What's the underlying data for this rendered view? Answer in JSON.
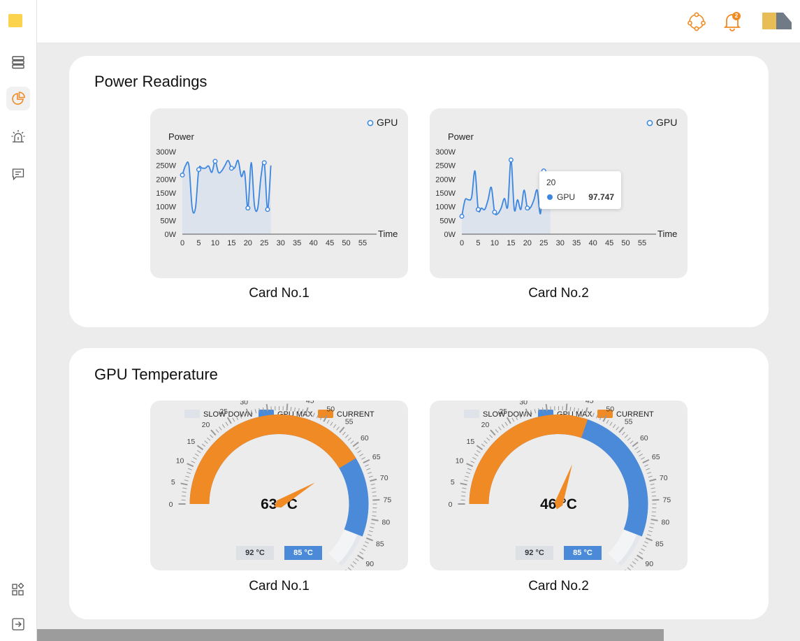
{
  "sidebar": {
    "items": [
      {
        "icon": "server-icon"
      },
      {
        "icon": "pie-chart-icon",
        "active": true
      },
      {
        "icon": "alarm-icon"
      },
      {
        "icon": "message-icon"
      },
      {
        "icon": "apps-icon"
      },
      {
        "icon": "logout-icon"
      }
    ]
  },
  "header": {
    "notifications_count": "2"
  },
  "colors": {
    "accent": "#f08a24",
    "line": "#3b86e0",
    "gpu_max": "#4a8ad8",
    "current": "#f08a24",
    "slow_down": "#dde3e8"
  },
  "power": {
    "title": "Power Readings",
    "cards": [
      {
        "caption": "Card No.1",
        "legend": "GPU",
        "ylabel": "Power",
        "xlabel": "Time"
      },
      {
        "caption": "Card No.2",
        "legend": "GPU",
        "ylabel": "Power",
        "xlabel": "Time",
        "tooltip": {
          "x": "20",
          "series": "GPU",
          "value": "97.747"
        }
      }
    ]
  },
  "temperature": {
    "title": "GPU Temperature",
    "legend": [
      "SLOW DOWN",
      "GPU MAX",
      "CURRENT"
    ],
    "cards": [
      {
        "caption": "Card No.1",
        "value_label": "63 °C",
        "slowdown_label": "92 °C",
        "max_label": "85 °C"
      },
      {
        "caption": "Card No.2",
        "value_label": "46 °C",
        "slowdown_label": "92 °C",
        "max_label": "85 °C"
      }
    ]
  },
  "chart_data": [
    {
      "type": "line",
      "title": "Card No.1",
      "xlabel": "Time",
      "ylabel": "Power",
      "x_ticks": [
        "0",
        "5",
        "10",
        "15",
        "20",
        "25",
        "30",
        "35",
        "40",
        "45",
        "50",
        "55"
      ],
      "y_ticks": [
        "0W",
        "50W",
        "100W",
        "150W",
        "200W",
        "250W",
        "300W"
      ],
      "xlim": [
        0,
        55
      ],
      "ylim": [
        0,
        300
      ],
      "series": [
        {
          "name": "GPU",
          "x": [
            0,
            1,
            2,
            3,
            4,
            5,
            6,
            7,
            8,
            9,
            10,
            11,
            12,
            13,
            14,
            15,
            16,
            17,
            18,
            19,
            20,
            21,
            22,
            23,
            24,
            25,
            26,
            27
          ],
          "values": [
            215,
            250,
            250,
            95,
            95,
            235,
            240,
            240,
            248,
            225,
            265,
            225,
            230,
            250,
            268,
            240,
            242,
            268,
            210,
            225,
            95,
            260,
            105,
            95,
            210,
            260,
            90,
            250
          ]
        }
      ]
    },
    {
      "type": "line",
      "title": "Card No.2",
      "xlabel": "Time",
      "ylabel": "Power",
      "x_ticks": [
        "0",
        "5",
        "10",
        "15",
        "20",
        "25",
        "30",
        "35",
        "40",
        "45",
        "50",
        "55"
      ],
      "y_ticks": [
        "0W",
        "50W",
        "100W",
        "150W",
        "200W",
        "250W",
        "300W"
      ],
      "xlim": [
        0,
        55
      ],
      "ylim": [
        0,
        300
      ],
      "series": [
        {
          "name": "GPU",
          "x": [
            0,
            1,
            2,
            3,
            4,
            5,
            6,
            7,
            8,
            9,
            10,
            11,
            12,
            13,
            14,
            15,
            16,
            17,
            18,
            19,
            20,
            21,
            22,
            23,
            24,
            25,
            26,
            27
          ],
          "values": [
            65,
            125,
            125,
            135,
            230,
            90,
            95,
            90,
            125,
            170,
            80,
            75,
            95,
            130,
            100,
            270,
            90,
            125,
            90,
            160,
            95,
            97.747,
            125,
            160,
            75,
            230,
            130,
            140
          ]
        }
      ]
    },
    {
      "type": "gauge",
      "title": "Card No.1",
      "min": 0,
      "max": 95,
      "current": 63,
      "gpu_max": 85,
      "slow_down": 92,
      "legend": [
        "SLOW DOWN",
        "GPU MAX",
        "CURRENT"
      ]
    },
    {
      "type": "gauge",
      "title": "Card No.2",
      "min": 0,
      "max": 95,
      "current": 46,
      "gpu_max": 85,
      "slow_down": 92,
      "legend": [
        "SLOW DOWN",
        "GPU MAX",
        "CURRENT"
      ]
    }
  ]
}
